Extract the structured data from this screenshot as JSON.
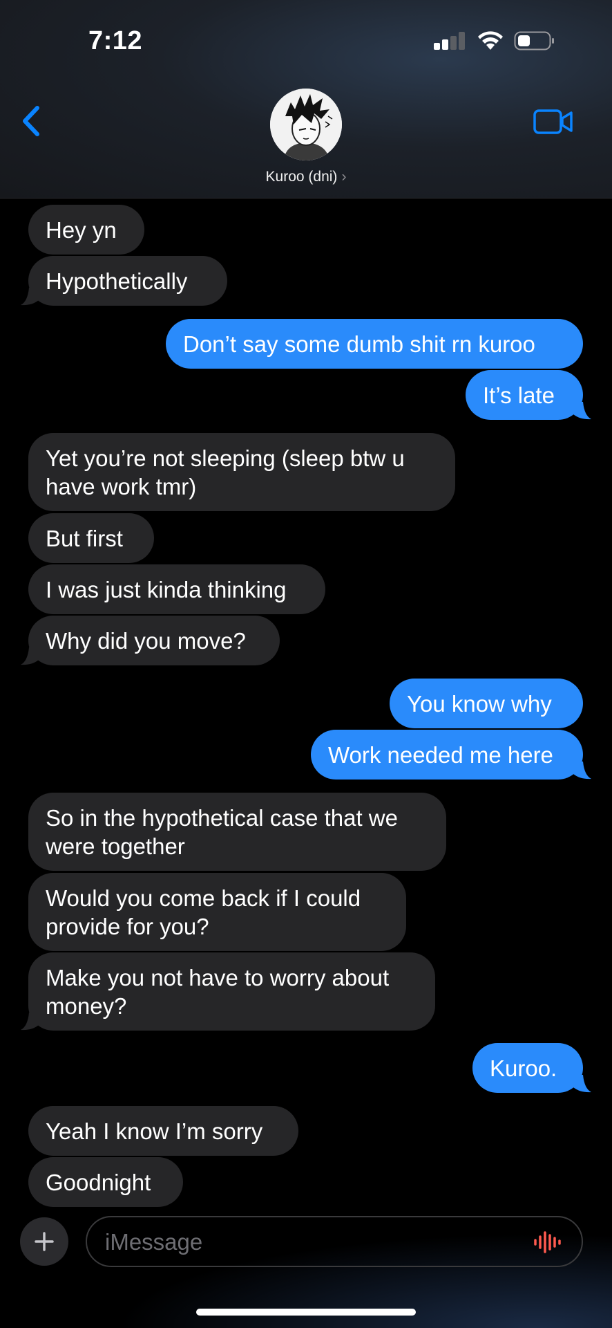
{
  "status_bar": {
    "time": "7:12"
  },
  "header": {
    "contact_name": "Kuroo (dni)",
    "chevron": "›"
  },
  "messages": [
    {
      "dir": "in",
      "lines": [
        "Hey yn"
      ]
    },
    {
      "dir": "in",
      "lines": [
        "Hypothetically"
      ]
    },
    {
      "dir": "out",
      "lines": [
        "Don’t say some dumb shit rn kuroo"
      ]
    },
    {
      "dir": "out",
      "lines": [
        "It’s late"
      ]
    },
    {
      "dir": "in",
      "lines": [
        "Yet you’re not sleeping (sleep btw u",
        "have work tmr)"
      ]
    },
    {
      "dir": "in",
      "lines": [
        "But first"
      ]
    },
    {
      "dir": "in",
      "lines": [
        "I was just kinda thinking"
      ]
    },
    {
      "dir": "in",
      "lines": [
        "Why did you move?"
      ]
    },
    {
      "dir": "out",
      "lines": [
        "You know why"
      ]
    },
    {
      "dir": "out",
      "lines": [
        "Work needed me here"
      ]
    },
    {
      "dir": "in",
      "lines": [
        "So in the hypothetical case that we",
        "were together"
      ]
    },
    {
      "dir": "in",
      "lines": [
        "Would you come back if I could",
        "provide for you?"
      ]
    },
    {
      "dir": "in",
      "lines": [
        "Make you not have to worry about",
        "money?"
      ]
    },
    {
      "dir": "out",
      "lines": [
        "Kuroo."
      ]
    },
    {
      "dir": "in",
      "lines": [
        "Yeah I know I’m sorry"
      ]
    },
    {
      "dir": "in",
      "lines": [
        "Goodnight"
      ]
    }
  ],
  "composer": {
    "placeholder": "iMessage",
    "value": ""
  },
  "icons": {
    "back": "chevron-left-icon",
    "video": "video-camera-icon",
    "plus": "plus-icon",
    "audio": "audio-waveform-icon"
  },
  "colors": {
    "accent": "#0a84ff",
    "outgoing": "#2a8bfb",
    "incoming": "#262628",
    "waveform": "#ff5a4f"
  }
}
